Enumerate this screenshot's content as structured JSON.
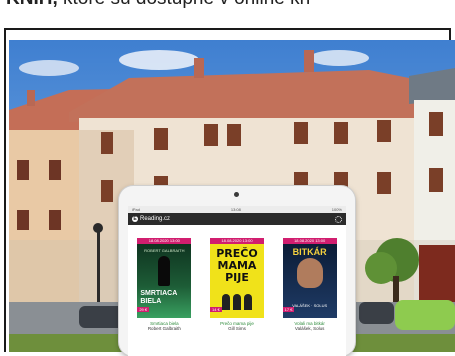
{
  "header": {
    "bold_text": "KNIH,",
    "normal_text": " ktoré sú dostupné v online kn"
  },
  "tablet": {
    "status_left": "iPad",
    "status_time": "13:08",
    "status_right": "100%",
    "app_logo_letter": "E",
    "app_name": "Reading.cz"
  },
  "books": [
    {
      "ribbon": "18.08.2020 13:00",
      "cover_author": "ROBERT GALBRAITH",
      "cover_title": "SMRTIACA BIELA",
      "price": "29 €",
      "title": "Smrtiaca biela",
      "author": "Robert Galbraith"
    },
    {
      "ribbon": "18.08.2020 13:00",
      "cover_title": "PREČO MAMA PIJE",
      "price": "14 €",
      "title": "Prečo mama pije",
      "author": "Gill Sims"
    },
    {
      "ribbon": "18.08.2020 13:00",
      "cover_title": "BITKÁR",
      "cover_tag": "VALÁŠEK · SOLUS",
      "price": "17 €",
      "title": "Volali ma bitkár",
      "author": "Valášek, Solus"
    }
  ],
  "colors": {
    "ribbon": "#d11e6f",
    "book_title": "#2c8a3a",
    "app_bar": "#2b2b2b",
    "frame_border": "#1a1a1a"
  }
}
